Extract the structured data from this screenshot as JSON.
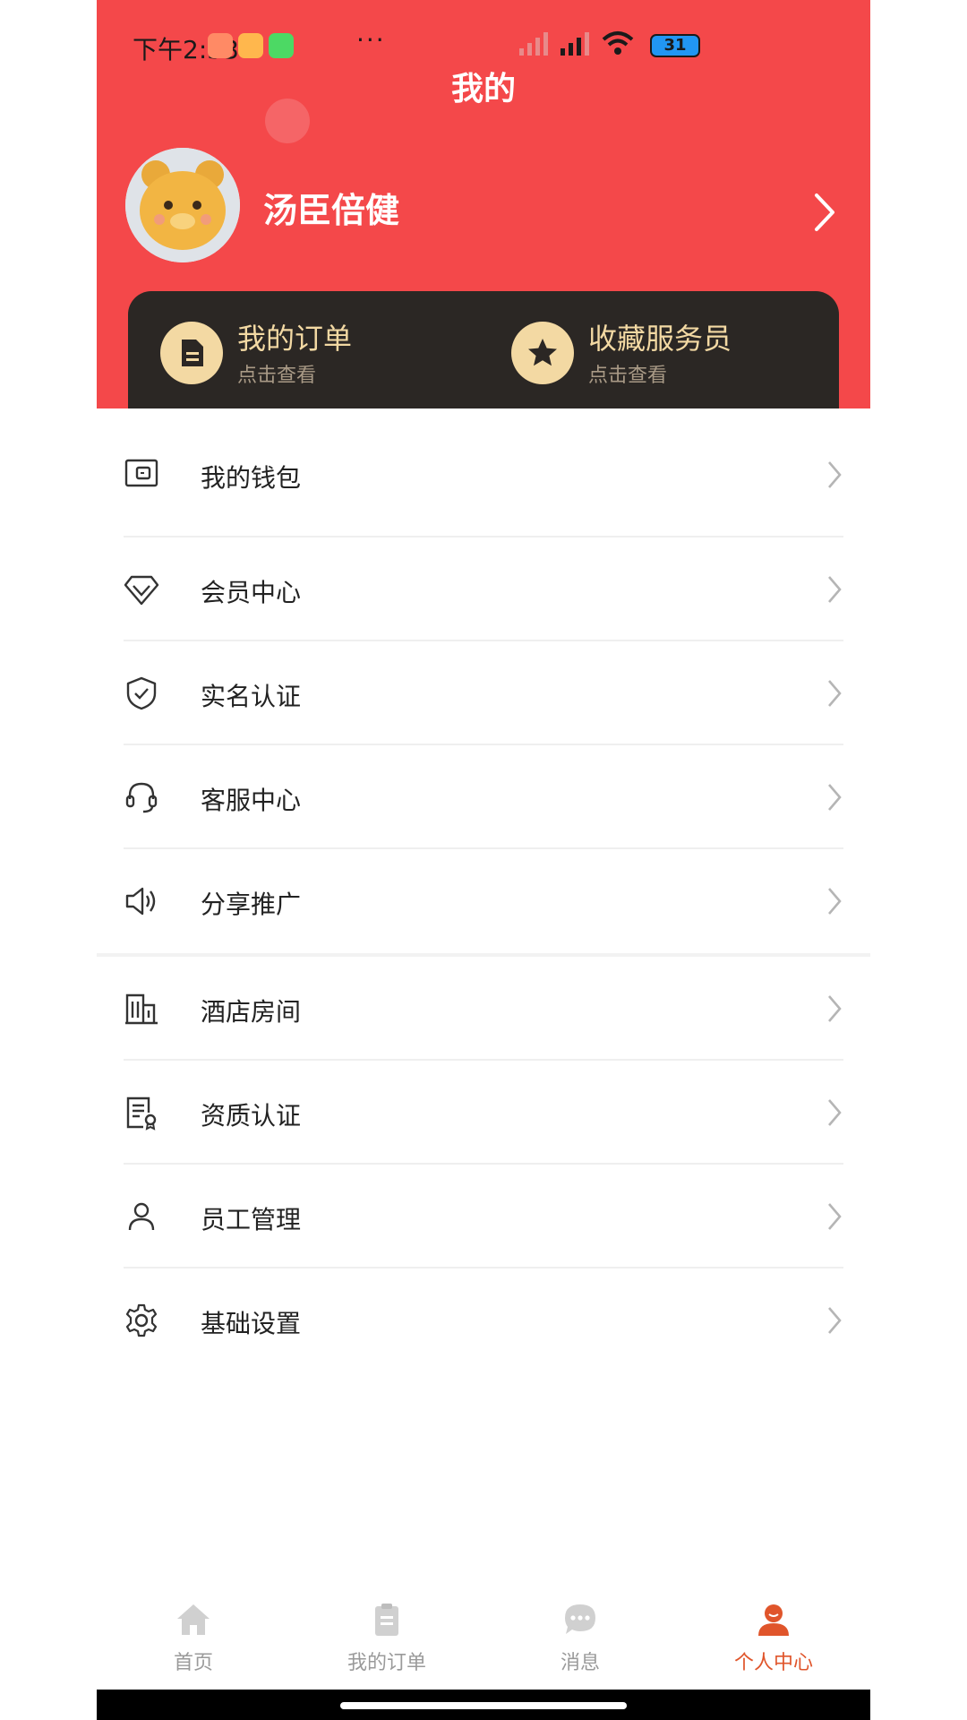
{
  "status_bar": {
    "time": "下午2:53",
    "battery": "31"
  },
  "header": {
    "title": "我的"
  },
  "profile": {
    "name": "汤臣倍健"
  },
  "quick_cards": [
    {
      "title": "我的订单",
      "subtitle": "点击查看",
      "icon": "document-icon"
    },
    {
      "title": "收藏服务员",
      "subtitle": "点击查看",
      "icon": "star-icon"
    }
  ],
  "menu": [
    {
      "label": "我的钱包",
      "icon": "wallet-icon"
    },
    {
      "label": "会员中心",
      "icon": "diamond-icon"
    },
    {
      "label": "实名认证",
      "icon": "shield-check-icon"
    },
    {
      "label": "客服中心",
      "icon": "headset-icon"
    },
    {
      "label": "分享推广",
      "icon": "speaker-icon"
    },
    {
      "label": "酒店房间",
      "icon": "building-icon"
    },
    {
      "label": "资质认证",
      "icon": "certificate-icon"
    },
    {
      "label": "员工管理",
      "icon": "user-icon"
    },
    {
      "label": "基础设置",
      "icon": "gear-icon"
    }
  ],
  "tabbar": [
    {
      "label": "首页",
      "icon": "home-icon"
    },
    {
      "label": "我的订单",
      "icon": "clipboard-icon"
    },
    {
      "label": "消息",
      "icon": "chat-icon"
    },
    {
      "label": "个人中心",
      "icon": "person-icon",
      "active": true
    }
  ],
  "colors": {
    "header": "#f4484a",
    "card": "#2b2724",
    "gold": "#f3d9a3",
    "active_tab": "#e0552b"
  }
}
